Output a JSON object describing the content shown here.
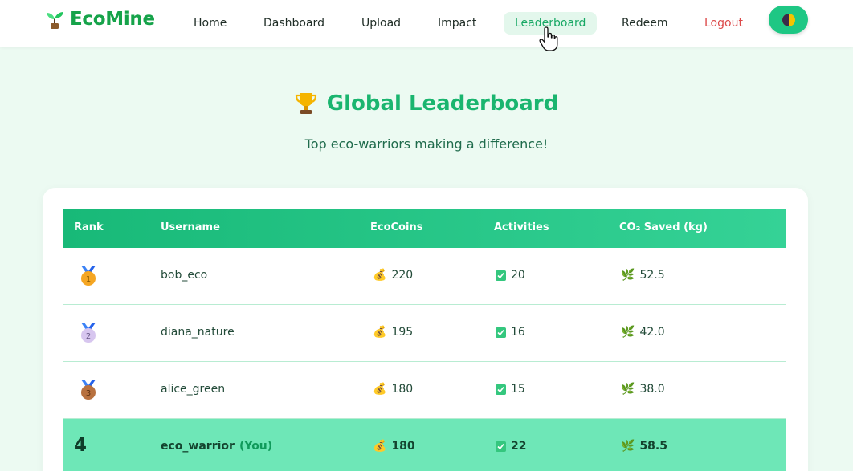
{
  "nav": {
    "brand": "EcoMine",
    "links": [
      "Home",
      "Dashboard",
      "Upload",
      "Impact",
      "Leaderboard",
      "Redeem",
      "Logout"
    ]
  },
  "hero": {
    "title": "Global Leaderboard",
    "subtitle": "Top eco-warriors making a difference!"
  },
  "table": {
    "headers": [
      "Rank",
      "Username",
      "EcoCoins",
      "Activities",
      "CO₂ Saved (kg)"
    ],
    "rows": [
      {
        "rank": "1",
        "username": "bob_eco",
        "coins": "220",
        "activities": "20",
        "co2": "52.5"
      },
      {
        "rank": "2",
        "username": "diana_nature",
        "coins": "195",
        "activities": "16",
        "co2": "42.0"
      },
      {
        "rank": "3",
        "username": "alice_green",
        "coins": "180",
        "activities": "15",
        "co2": "38.0"
      },
      {
        "rank": "4",
        "username": "eco_warrior",
        "you": "(You)",
        "coins": "180",
        "activities": "22",
        "co2": "58.5"
      }
    ]
  },
  "colors": {
    "accent": "#1ab56f",
    "highlight_row": "#6ee7b7",
    "logout": "#dc4a4a"
  }
}
